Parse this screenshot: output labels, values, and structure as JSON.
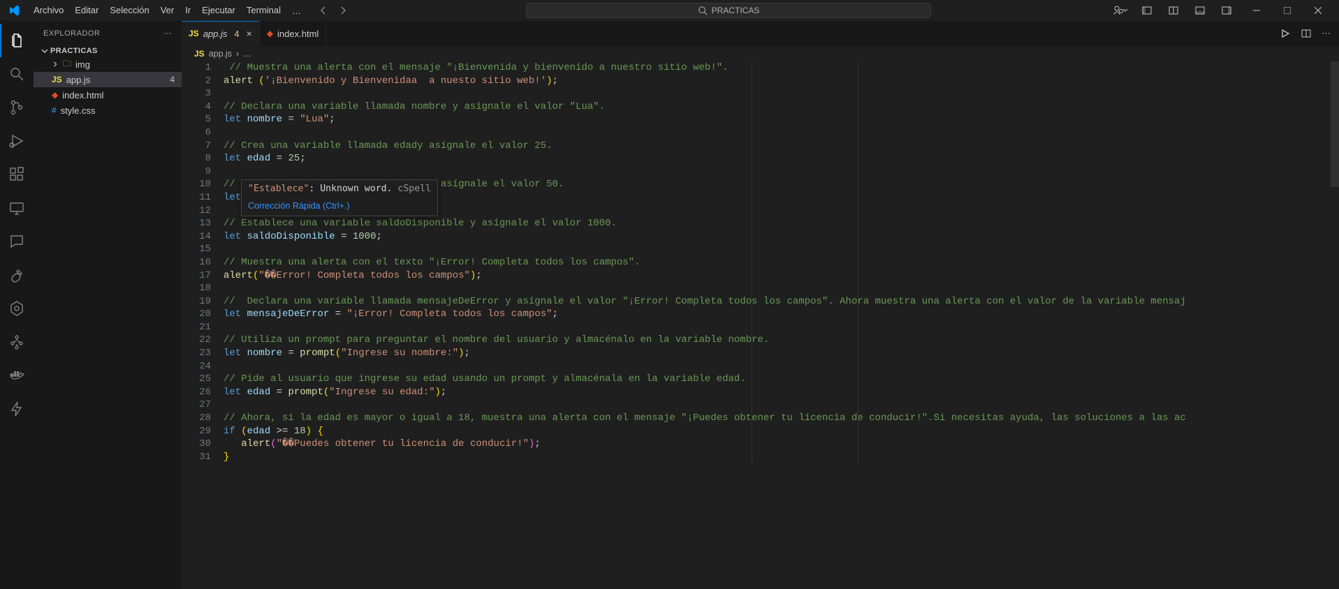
{
  "menu": {
    "items": [
      "Archivo",
      "Editar",
      "Selección",
      "Ver",
      "Ir",
      "Ejecutar",
      "Terminal"
    ],
    "more": "…"
  },
  "commandCenter": {
    "label": "PRACTICAS"
  },
  "sidebar": {
    "title": "EXPLORADOR",
    "folder": "PRACTICAS",
    "files": [
      {
        "name": "img",
        "type": "folder"
      },
      {
        "name": "app.js",
        "type": "js",
        "problems": "4",
        "selected": true
      },
      {
        "name": "index.html",
        "type": "html"
      },
      {
        "name": "style.css",
        "type": "css"
      }
    ]
  },
  "tabs": [
    {
      "name": "app.js",
      "type": "js",
      "italic": true,
      "problems": "4",
      "active": true,
      "closable": true
    },
    {
      "name": "index.html",
      "type": "html",
      "italic": false,
      "active": false
    }
  ],
  "breadcrumb": {
    "icon": "js",
    "file": "app.js",
    "sep": "›",
    "scope": "..."
  },
  "hover": {
    "word": "\"Establece\"",
    "colon": ": ",
    "msg": "Unknown word. ",
    "src": "cSpell",
    "quickfix": "Corrección Rápida (Ctrl+.)"
  },
  "code": {
    "lines": [
      {
        "n": 1,
        "html": " <span class='tok-comment'>// Muestra una alerta con el mensaje \"¡Bienvenida y bienvenido a nuestro sitio web!\".</span>"
      },
      {
        "n": 2,
        "html": "<span class='tok-fn'>alert</span> <span class='tok-br1'>(</span><span class='tok-str'>'¡Bienvenido y Bienvenidaa  a nuesto sitio web!'</span><span class='tok-br1'>)</span><span class='tok-pn'>;</span>"
      },
      {
        "n": 3,
        "html": ""
      },
      {
        "n": 4,
        "html": "<span class='tok-comment'>// Declara una variable llamada nombre y asígnale el valor \"Lua\".</span>"
      },
      {
        "n": 5,
        "html": "<span class='tok-kw'>let</span> <span class='tok-var'>nombre</span> <span class='tok-pn'>=</span> <span class='tok-str'>\"Lua\"</span><span class='tok-pn'>;</span>"
      },
      {
        "n": 6,
        "html": ""
      },
      {
        "n": 7,
        "html": "<span class='tok-comment'>// Crea una variable llamada edady asígnale el valor 25.</span>"
      },
      {
        "n": 8,
        "html": "<span class='tok-kw'>let</span> <span class='tok-var'>edad</span> <span class='tok-pn'>=</span> <span class='tok-num'>25</span><span class='tok-pn'>;</span>"
      },
      {
        "n": 9,
        "html": ""
      },
      {
        "n": 10,
        "html": "<span class='tok-comment'>//</span>                              <span class='tok-comment'>as y asígnale el valor 50.</span>"
      },
      {
        "n": 11,
        "html": "<span class='tok-kw'>let</span>"
      },
      {
        "n": 12,
        "html": ""
      },
      {
        "n": 13,
        "html": "<span class='tok-comment'>// Establece una variable saldoDisponible y asígnale el valor 1000.</span>"
      },
      {
        "n": 14,
        "html": "<span class='tok-kw'>let</span> <span class='tok-var'>saldoDisponible</span> <span class='tok-pn'>=</span> <span class='tok-num'>1000</span><span class='tok-pn'>;</span>"
      },
      {
        "n": 15,
        "html": ""
      },
      {
        "n": 16,
        "html": "<span class='tok-comment'>// Muestra una alerta con el texto \"¡Error! Completa todos los campos\".</span>"
      },
      {
        "n": 17,
        "html": "<span class='tok-fn'>alert</span><span class='tok-br1'>(</span><span class='tok-str'>\"��Error! Completa todos los campos\"</span><span class='tok-br1'>)</span><span class='tok-pn'>;</span>"
      },
      {
        "n": 18,
        "html": ""
      },
      {
        "n": 19,
        "html": "<span class='tok-comment'>//  Declara una variable llamada mensajeDeError y asígnale el valor \"¡Error! Completa todos los campos\". Ahora muestra una alerta con el valor de la variable mensaj</span>"
      },
      {
        "n": 20,
        "html": "<span class='tok-kw'>let</span> <span class='tok-var'>mensajeDeError</span> <span class='tok-pn'>=</span> <span class='tok-str'>\"¡Error! Completa todos los campos\"</span><span class='tok-pn'>;</span>"
      },
      {
        "n": 21,
        "html": ""
      },
      {
        "n": 22,
        "html": "<span class='tok-comment'>// Utiliza un prompt para preguntar el nombre del usuario y almacénalo en la variable nombre.</span>"
      },
      {
        "n": 23,
        "html": "<span class='tok-kw'>let</span> <span class='tok-var'>nombre</span> <span class='tok-pn'>=</span> <span class='tok-fn'>prompt</span><span class='tok-br1'>(</span><span class='tok-str'>\"Ingrese su nombre:\"</span><span class='tok-br1'>)</span><span class='tok-pn'>;</span>"
      },
      {
        "n": 24,
        "html": ""
      },
      {
        "n": 25,
        "html": "<span class='tok-comment'>// Pide al usuario que ingrese su edad usando un prompt y almacénala en la variable edad.</span>"
      },
      {
        "n": 26,
        "html": "<span class='tok-kw'>let</span> <span class='tok-var'>edad</span> <span class='tok-pn'>=</span> <span class='tok-fn'>prompt</span><span class='tok-br1'>(</span><span class='tok-str'>\"Ingrese su edad:\"</span><span class='tok-br1'>)</span><span class='tok-pn'>;</span>"
      },
      {
        "n": 27,
        "html": ""
      },
      {
        "n": 28,
        "html": "<span class='tok-comment'>// Ahora, si la edad es mayor o igual a 18, muestra una alerta con el mensaje \"¡Puedes obtener tu licencia de conducir!\".Si necesitas ayuda, las soluciones a las ac</span>"
      },
      {
        "n": 29,
        "html": "<span class='tok-kw'>if</span> <span class='tok-br1'>(</span><span class='tok-var'>edad</span> <span class='tok-pn'>&gt;=</span> <span class='tok-num'>18</span><span class='tok-br1'>)</span> <span class='tok-br1'>{</span>"
      },
      {
        "n": 30,
        "html": "   <span class='tok-fn'>alert</span><span class='tok-br2'>(</span><span class='tok-str'>\"��Puedes obtener tu licencia de conducir!\"</span><span class='tok-br2'>)</span><span class='tok-pn'>;</span>"
      },
      {
        "n": 31,
        "html": "<span class='tok-br1'>}</span>"
      }
    ]
  }
}
